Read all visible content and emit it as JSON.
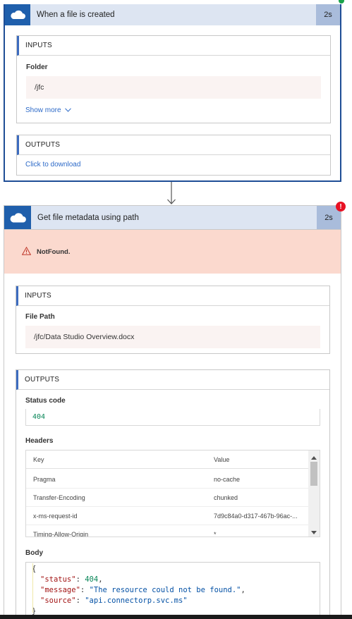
{
  "step1": {
    "title": "When a file is created",
    "duration": "2s",
    "app_icon": "onedrive-cloud-icon",
    "inputs": {
      "heading": "INPUTS",
      "folder_label": "Folder",
      "folder_value": "/jfc",
      "show_more": "Show more"
    },
    "outputs": {
      "heading": "OUTPUTS",
      "download_link": "Click to download"
    }
  },
  "connector_icon": "down-arrow-icon",
  "step2": {
    "title": "Get file metadata using path",
    "duration": "2s",
    "app_icon": "onedrive-cloud-icon",
    "error": {
      "message": "NotFound.",
      "icon": "warning-triangle-icon",
      "badge_icon": "error-badge-icon",
      "color": "#fbd9ce"
    },
    "inputs": {
      "heading": "INPUTS",
      "file_path_label": "File Path",
      "file_path_value": "/jfc/Data Studio Overview.docx"
    },
    "outputs": {
      "heading": "OUTPUTS",
      "status_code_label": "Status code",
      "status_code_value": "404",
      "headers_label": "Headers",
      "headers_columns": {
        "key": "Key",
        "value": "Value"
      },
      "headers_rows": [
        {
          "key": "Pragma",
          "value": "no-cache"
        },
        {
          "key": "Transfer-Encoding",
          "value": "chunked"
        },
        {
          "key": "x-ms-request-id",
          "value": "7d9c84a0-d317-467b-96ac-..."
        },
        {
          "key": "Timing-Allow-Origin",
          "value": "*"
        }
      ],
      "body_label": "Body",
      "body_json": {
        "open": "{",
        "status_key": "\"status\"",
        "status_value": "404",
        "message_key": "\"message\"",
        "message_value": "\"The resource could not be found.\"",
        "source_key": "\"source\"",
        "source_value": "\"api.connectorp.svc.ms\"",
        "close": "}"
      }
    }
  },
  "colors": {
    "accent_blue": "#1f5fac",
    "header_bg": "#dde5f2",
    "error_red": "#e81123",
    "link_blue": "#2d6ac8"
  }
}
